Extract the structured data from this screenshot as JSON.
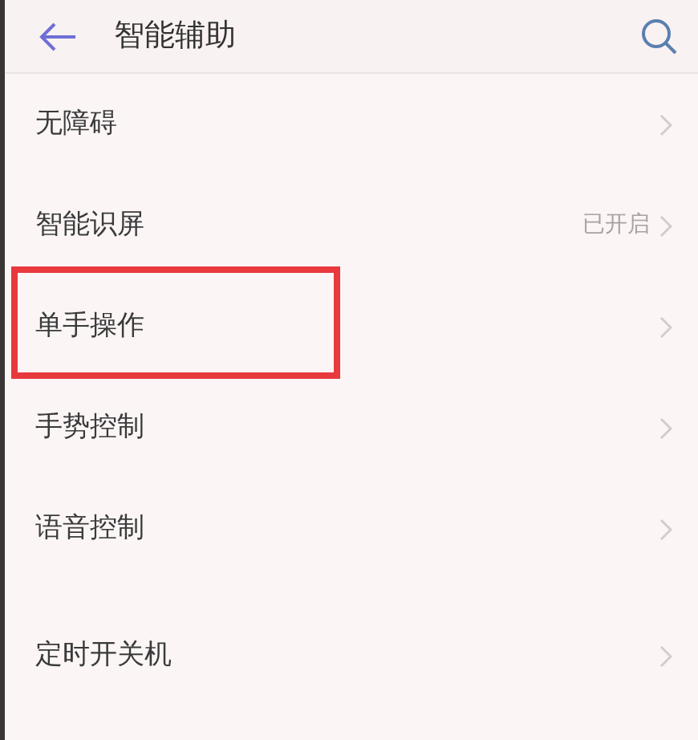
{
  "header": {
    "title": "智能辅助"
  },
  "groups": [
    {
      "items": [
        {
          "label": "无障碍",
          "highlighted": false
        },
        {
          "label": "智能识屏",
          "value": "已开启",
          "highlighted": false
        },
        {
          "label": "单手操作",
          "highlighted": true
        },
        {
          "label": "手势控制",
          "highlighted": false
        },
        {
          "label": "语音控制",
          "highlighted": false
        }
      ]
    },
    {
      "items": [
        {
          "label": "定时开关机",
          "highlighted": false
        }
      ]
    }
  ]
}
